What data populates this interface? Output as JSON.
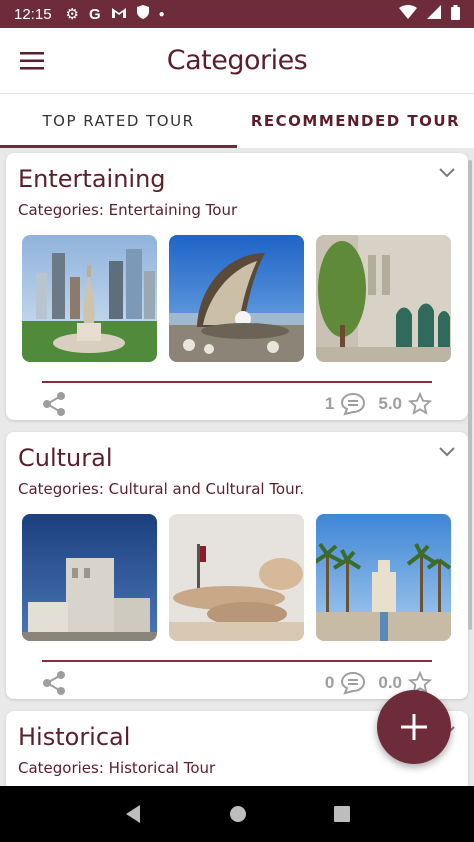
{
  "status_bar": {
    "time": "12:15",
    "colors": {
      "bar": "#6e2c3a"
    }
  },
  "app_bar": {
    "title": "Categories"
  },
  "tabs": [
    {
      "label": "TOP RATED TOUR",
      "active": true
    },
    {
      "label": "RECOMMENDED TOUR",
      "active": false
    }
  ],
  "cards": [
    {
      "title": "Entertaining",
      "subtitle": "Categories: Entertaining Tour",
      "comments": "1",
      "rating": "5.0",
      "images": [
        "doha-skyline-dallah-monument",
        "pearl-monument",
        "mosque-courtyard-trees"
      ]
    },
    {
      "title": "Cultural",
      "subtitle": "Categories: Cultural and Cultural Tour.",
      "comments": "0",
      "rating": "0.0",
      "images": [
        "fire-station-museum",
        "national-museum-desert-rose",
        "museum-islamic-art-palms"
      ]
    },
    {
      "title": "Historical",
      "subtitle": "Categories: Historical Tour"
    }
  ],
  "theme": {
    "accent": "#6e2c3a",
    "text": "#5a1e2c"
  }
}
